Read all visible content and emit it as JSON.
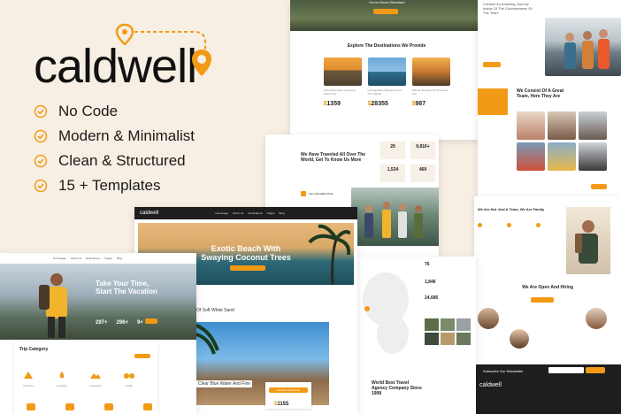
{
  "logo": {
    "text": "caldwell"
  },
  "features": [
    "No Code",
    "Modern & Minimalist",
    "Clean & Structured",
    "15 + Templates"
  ],
  "colors": {
    "accent": "#f29a16",
    "bg": "#f7efe3",
    "dark": "#1e1e1e"
  },
  "top_hero": {
    "caption": "You've Never Breathed"
  },
  "destinations": {
    "title": "Explore The Destinations We Provide",
    "items": [
      {
        "name": "Natural Wonders Adventure Hiking Tour",
        "price": "1359"
      },
      {
        "name": "Unforgettable Sailing Around The Islands",
        "price": "28355"
      },
      {
        "name": "Natural Wonders Of Adventure Tour",
        "price": "987"
      }
    ]
  },
  "about": {
    "title": "Created An Amazing Journey Inside Of The Cohesiveness Of The Team"
  },
  "team": {
    "title": "We Consist Of A Great Team, Here They Are"
  },
  "traveled": {
    "title": "We Have Traveled All Over The World, Get To Know Us More",
    "stats": [
      "29",
      "9,816+",
      "1,534",
      "469"
    ],
    "step": "Very Affordable Price"
  },
  "family": {
    "title": "We Are Not Just A Team, We Are Family"
  },
  "hiring": {
    "title": "We Are Open And Hiring"
  },
  "newsletter": {
    "label": "Subscribe Our Newsletter"
  },
  "exotic": {
    "brand": "caldwell",
    "nav": [
      "Homepage",
      "About Us",
      "Destinations",
      "Pages",
      "Blog"
    ],
    "hero_line1": "Exotic Beach With",
    "hero_line2": "Swaying Coconut Trees",
    "side_text": "Of Soft White Sand",
    "bottom_text": "Clear Blue Water And Fine",
    "bottom_sub": "d",
    "price": "1155",
    "booking_label": "Continue & Booking"
  },
  "vacation": {
    "nav": [
      "Homepage",
      "About Us",
      "Destinations",
      "Pages",
      "Blog"
    ],
    "hero_line1": "Take Your Time,",
    "hero_line2": "Start The Vacation",
    "stats": [
      {
        "value": "297+",
        "label": ""
      },
      {
        "value": "296+",
        "label": ""
      },
      {
        "value": "9+",
        "label": ""
      }
    ],
    "trip_title": "Trip Category",
    "categories": [
      "Climbers",
      "Camping",
      "Adventure",
      "Safari"
    ]
  },
  "world": {
    "stats": [
      "76",
      "1,846",
      "24,685"
    ],
    "title": "World Best Travel Agency Company Since 1998"
  },
  "footer": {
    "brand": "caldwell"
  }
}
